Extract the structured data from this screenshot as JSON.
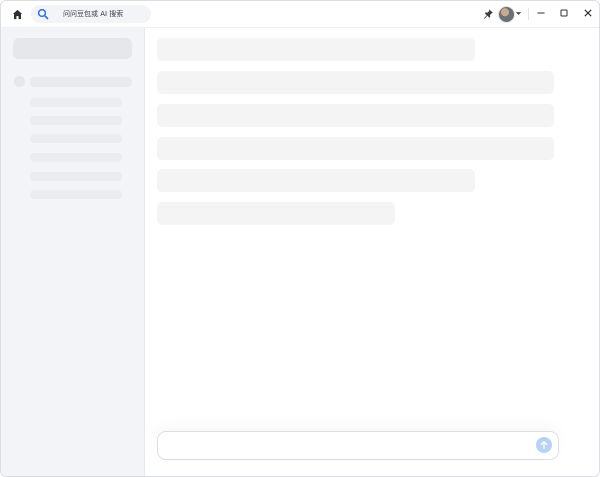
{
  "titlebar": {
    "search_placeholder": "问问豆包或 AI 搜索"
  },
  "icons": {
    "home": "home-icon",
    "search": "search-icon",
    "pin": "pin-icon",
    "caret": "chevron-down-icon",
    "minimize": "minimize-icon",
    "maximize": "maximize-icon",
    "close": "close-icon",
    "send": "arrow-up-icon"
  },
  "colors": {
    "accent": "#2f6fe8",
    "send_button": "#b7d2f5",
    "sidebar_bg": "#f3f4f7",
    "skeleton": "#f4f4f5"
  }
}
